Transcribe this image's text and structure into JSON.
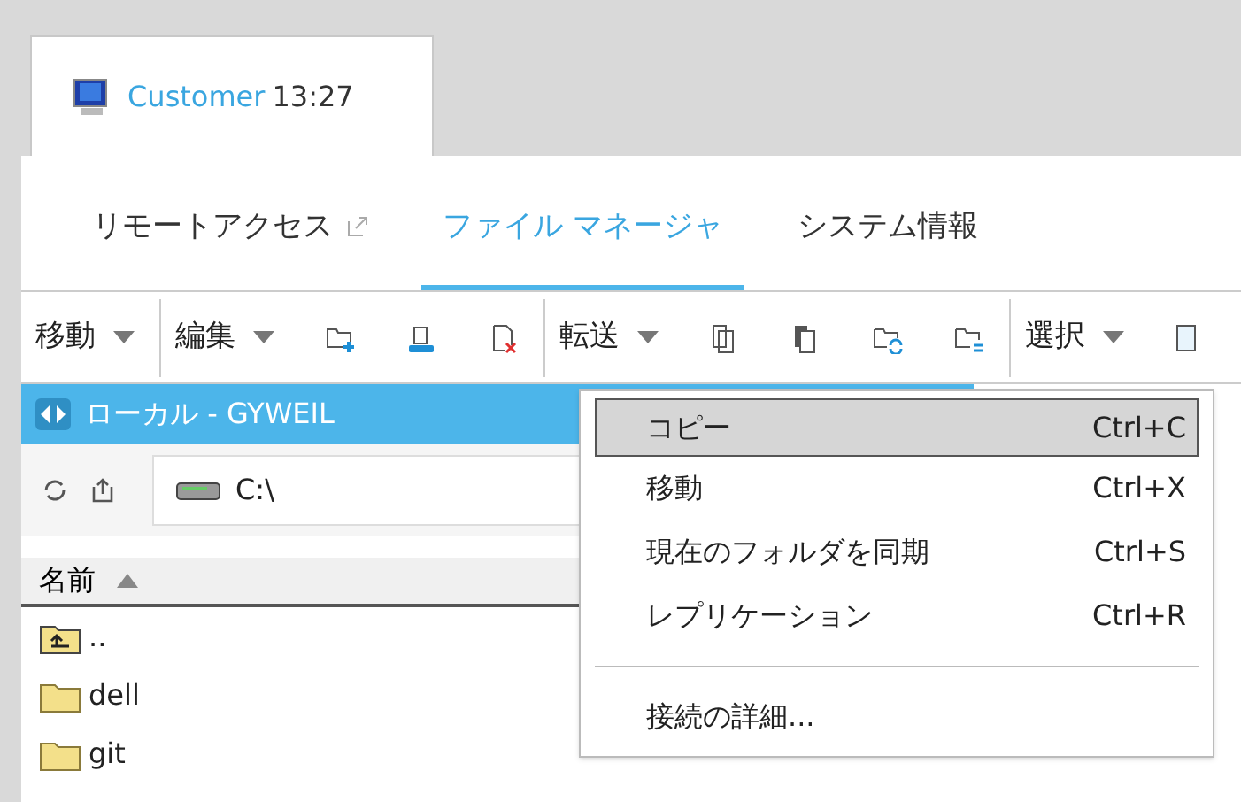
{
  "session_tab": {
    "name": "Customer",
    "time": "13:27"
  },
  "nav_tabs": [
    {
      "label": "リモートアクセス",
      "external": true,
      "selected": false
    },
    {
      "label": "ファイル マネージャ",
      "external": false,
      "selected": true
    },
    {
      "label": "システム情報",
      "external": false,
      "selected": false
    }
  ],
  "toolbar": [
    {
      "kind": "menu",
      "label": "移動"
    },
    {
      "kind": "divider"
    },
    {
      "kind": "menu",
      "label": "編集"
    },
    {
      "kind": "icon"
    },
    {
      "kind": "icon"
    },
    {
      "kind": "icon"
    },
    {
      "kind": "divider"
    },
    {
      "kind": "menu",
      "label": "転送"
    },
    {
      "kind": "icon"
    },
    {
      "kind": "icon"
    },
    {
      "kind": "icon"
    },
    {
      "kind": "icon"
    },
    {
      "kind": "divider"
    },
    {
      "kind": "menu",
      "label": "選択"
    },
    {
      "kind": "icon"
    }
  ],
  "local_panel": {
    "title": "ローカル - GYWEIL",
    "path": "C:\\",
    "column": "名前",
    "files": [
      {
        "name": "..",
        "kind": "up"
      },
      {
        "name": "dell",
        "kind": "folder"
      },
      {
        "name": "git",
        "kind": "folder"
      }
    ]
  },
  "context_menu": [
    {
      "kind": "item",
      "label": "コピー",
      "shortcut": "Ctrl+C",
      "selected": true
    },
    {
      "kind": "item",
      "label": "移動",
      "shortcut": "Ctrl+X",
      "selected": false
    },
    {
      "kind": "item",
      "label": "現在のフォルダを同期",
      "shortcut": "Ctrl+S",
      "selected": false
    },
    {
      "kind": "item",
      "label": "レプリケーション",
      "shortcut": "Ctrl+R",
      "selected": false
    },
    {
      "kind": "separator"
    },
    {
      "kind": "item",
      "label": "接続の詳細...",
      "selected": false
    }
  ]
}
